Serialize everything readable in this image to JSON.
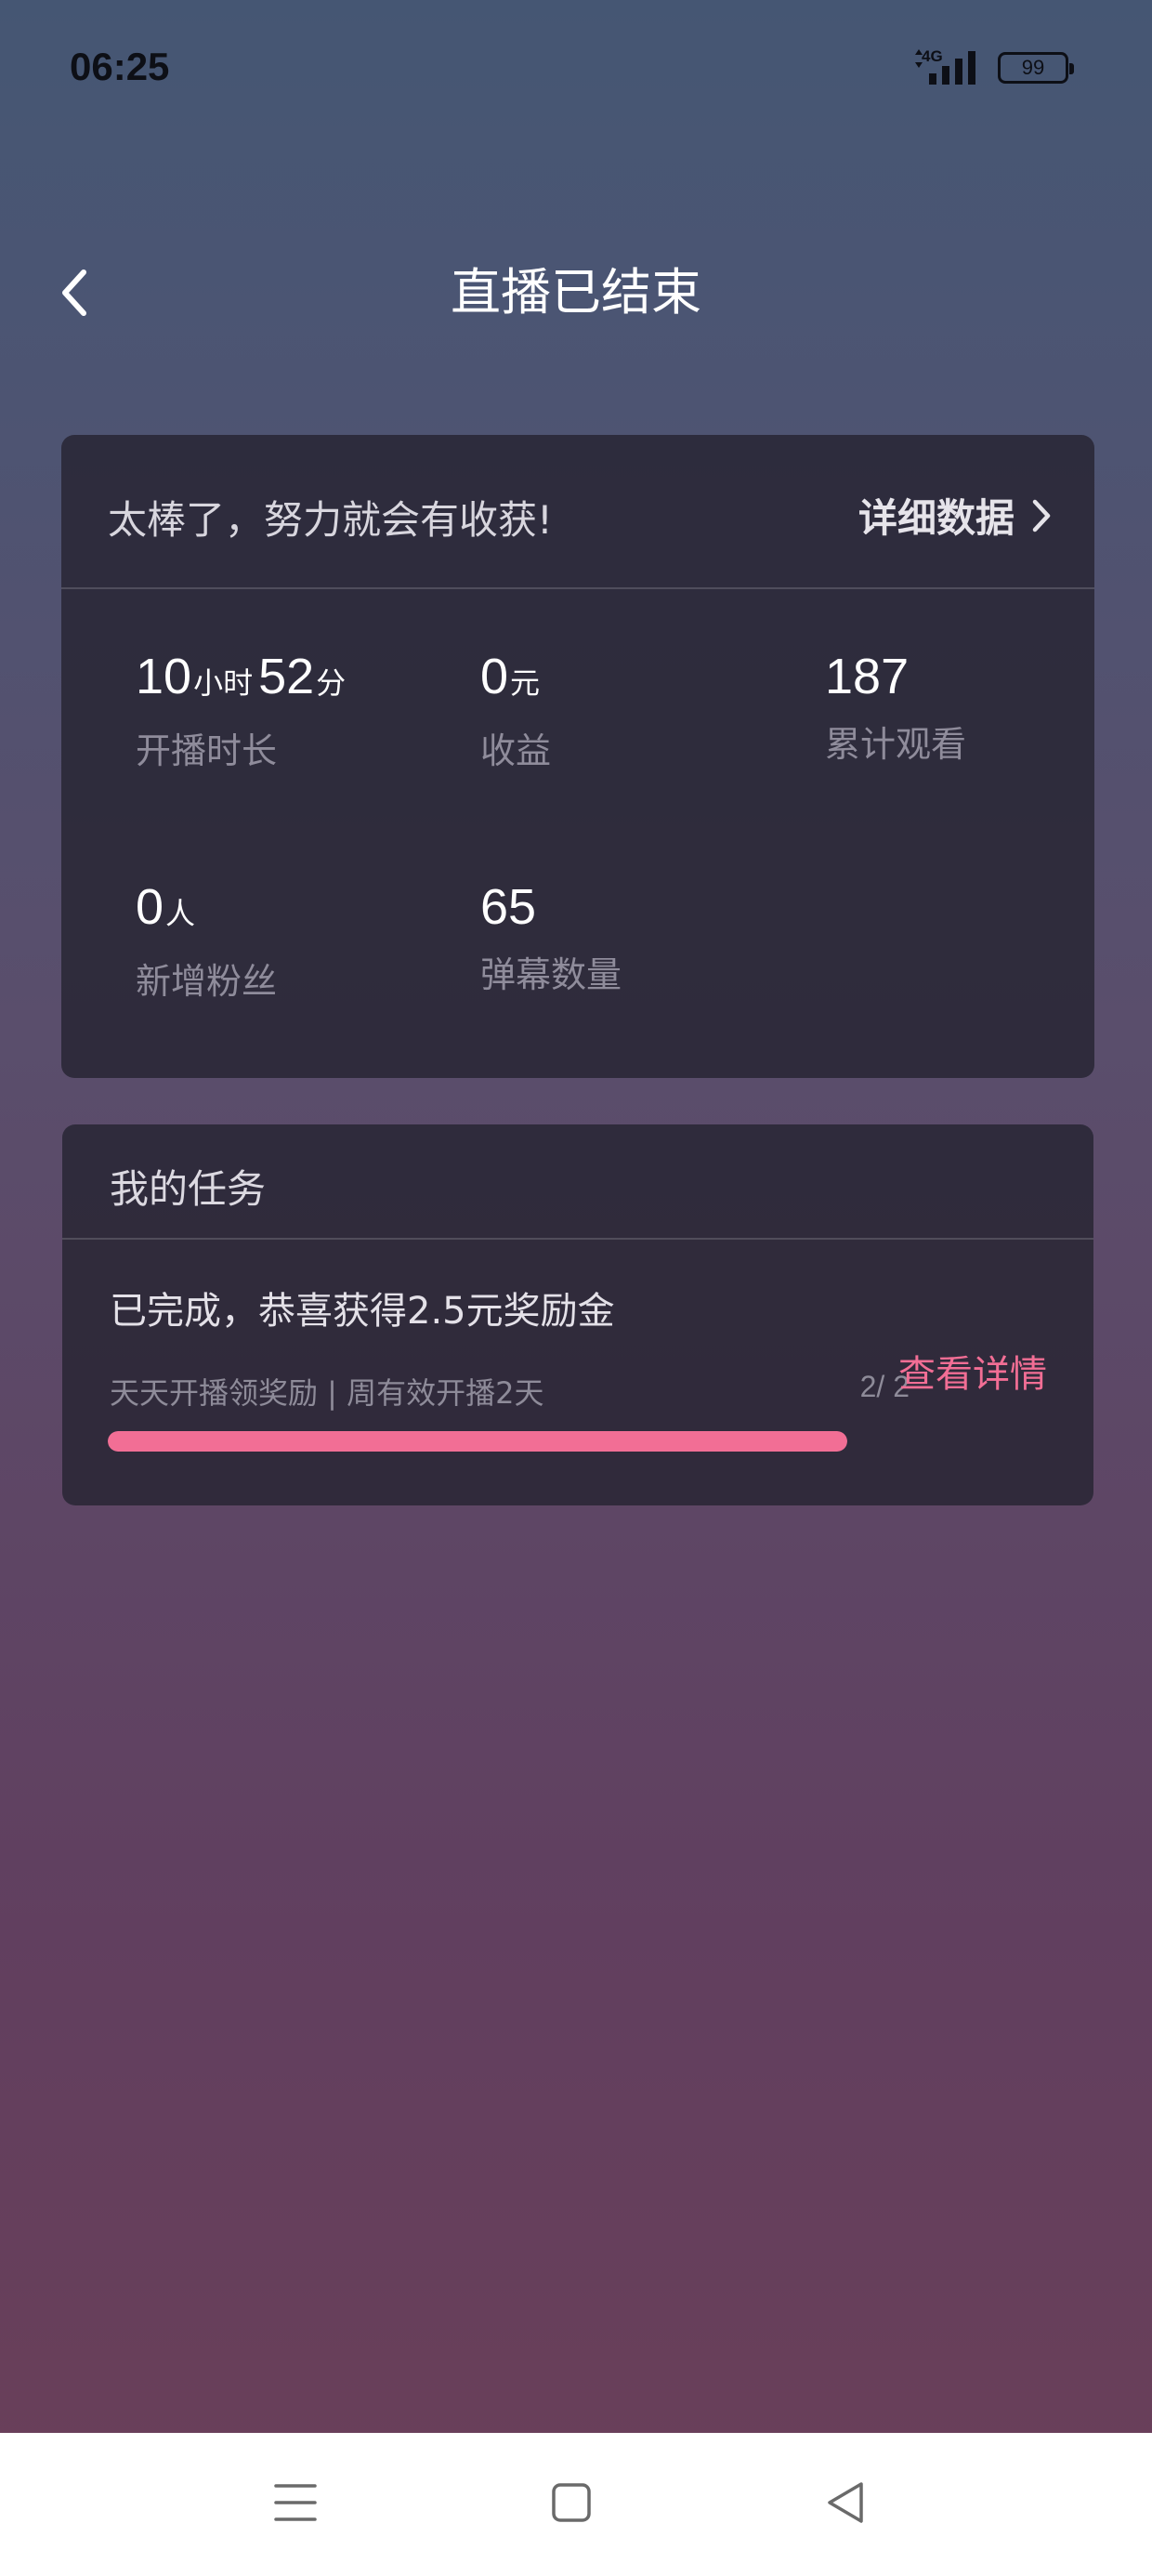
{
  "status_bar": {
    "time": "06:25",
    "network": "4G",
    "battery": "99"
  },
  "header": {
    "title": "直播已结束",
    "back_icon": "chevron-left-icon"
  },
  "summary": {
    "message": "太棒了，努力就会有收获!",
    "detail_label": "详细数据",
    "stats": [
      {
        "value_parts": [
          "10",
          "小时",
          "52",
          "分"
        ],
        "label": "开播时长"
      },
      {
        "value_parts": [
          "0",
          "元"
        ],
        "label": "收益"
      },
      {
        "value_parts": [
          "187"
        ],
        "label": "累计观看"
      },
      {
        "value_parts": [
          "0",
          "人"
        ],
        "label": "新增粉丝"
      },
      {
        "value_parts": [
          "65"
        ],
        "label": "弹幕数量"
      }
    ]
  },
  "tasks": {
    "title": "我的任务",
    "status": "已完成，恭喜获得2.5元奖励金",
    "description": "天天开播领奖励 | 周有效开播2天",
    "progress_text": "2/ 2",
    "progress": 1.0,
    "detail_button": "查看详情",
    "accent_color": "#f26e95"
  },
  "nav_bar": {
    "menu_icon": "menu-icon",
    "home_icon": "home-square-icon",
    "back_icon": "back-triangle-icon"
  }
}
